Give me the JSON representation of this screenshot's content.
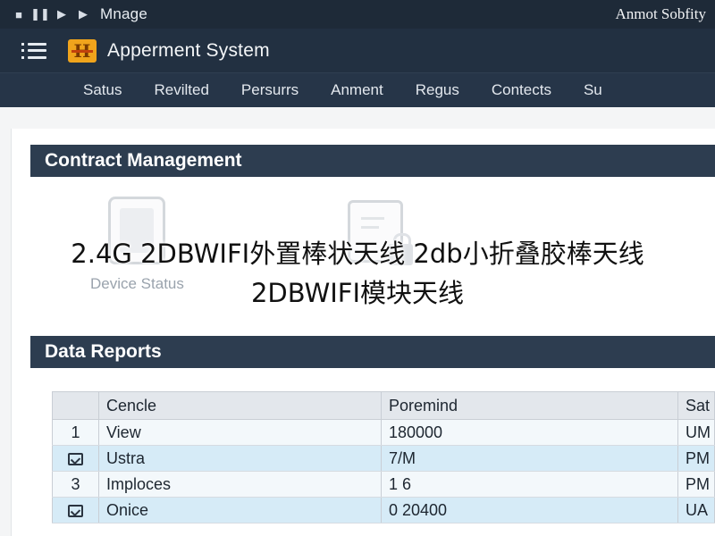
{
  "window": {
    "controls": [
      "■",
      "❚❚",
      "▶",
      "▶"
    ],
    "title": "Mnage",
    "user": "Anmot Sobfity"
  },
  "app": {
    "title": "Apperment System"
  },
  "nav": {
    "items": [
      "Satus",
      "Revilted",
      "Persurrs",
      "Anment",
      "Regus",
      "Contects",
      "Su"
    ]
  },
  "contract": {
    "header": "Contract Management",
    "widgets": [
      {
        "label": "Device Status",
        "icon": "device-icon"
      },
      {
        "label": "",
        "icon": "secure-document-icon"
      }
    ]
  },
  "overlay": {
    "line1": "2.4G 2DBWIFI外置棒状天线 2db小折叠胶棒天线",
    "line2": "2DBWIFI模块天线"
  },
  "reports": {
    "header": "Data Reports",
    "columns": [
      "",
      "Cencle",
      "Poremind",
      "Sat"
    ],
    "rows": [
      {
        "idx": "1",
        "check": false,
        "name": "View",
        "value": "180000",
        "status": "UM"
      },
      {
        "idx": "",
        "check": true,
        "name": "Ustra",
        "value": "7/M",
        "status": "PM"
      },
      {
        "idx": "3",
        "check": false,
        "name": "Imploces",
        "value": "1 6",
        "status": "PM"
      },
      {
        "idx": "",
        "check": true,
        "name": "Onice",
        "value": "0 20400",
        "status": "UA"
      }
    ]
  },
  "colors": {
    "topbar": "#1e2a38",
    "appbar": "#223041",
    "section_header": "#2d3d50",
    "row_highlight": "#d6ebf7",
    "logo": "#f0a41c"
  }
}
